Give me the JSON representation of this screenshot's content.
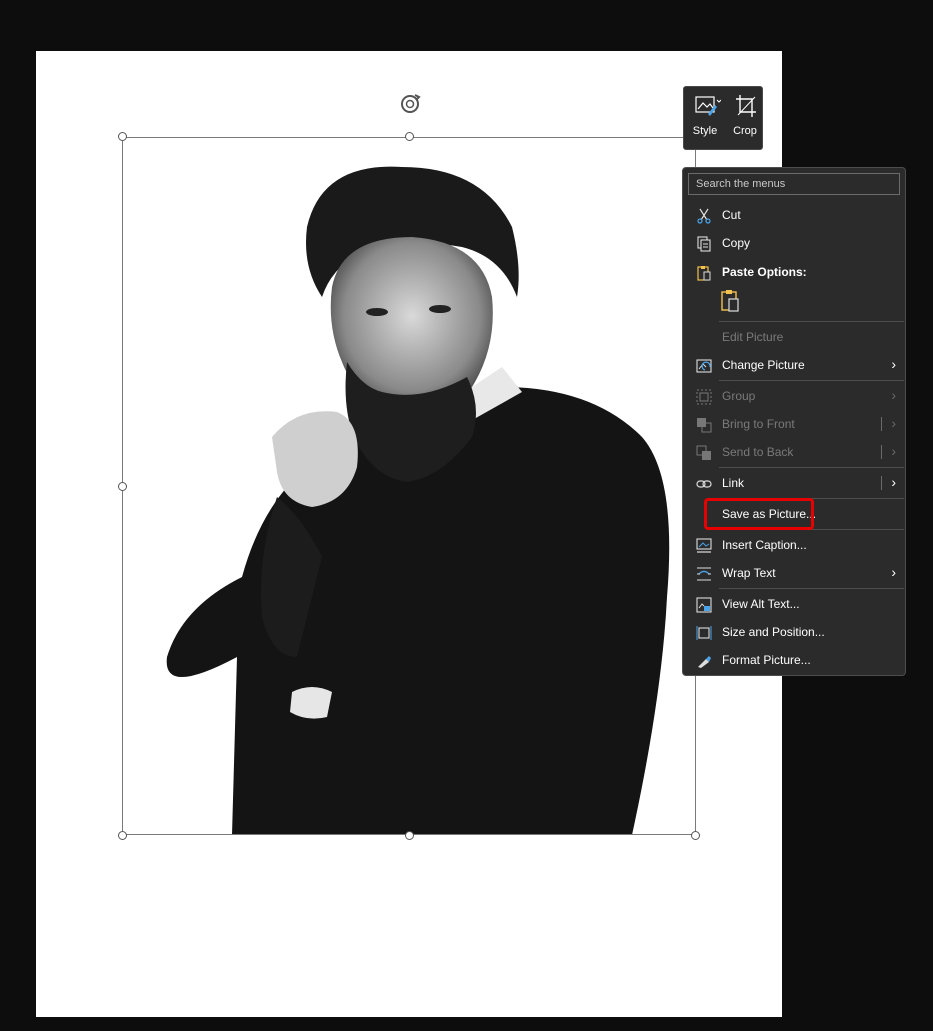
{
  "mini_toolbar": {
    "style_label": "Style",
    "crop_label": "Crop"
  },
  "context_menu": {
    "search_placeholder": "Search the menus",
    "cut": "Cut",
    "copy": "Copy",
    "paste_options": "Paste Options:",
    "edit_picture": "Edit Picture",
    "change_picture": "Change Picture",
    "group": "Group",
    "bring_to_front": "Bring to Front",
    "send_to_back": "Send to Back",
    "link": "Link",
    "save_as_picture": "Save as Picture...",
    "insert_caption": "Insert Caption...",
    "wrap_text": "Wrap Text",
    "view_alt_text": "View Alt Text...",
    "size_and_position": "Size and Position...",
    "format_picture": "Format Picture..."
  },
  "colors": {
    "menu_bg": "#2b2b2b",
    "highlight": "#e60000",
    "accent_icon": "#4aa3e8",
    "paste_icon": "#f2c14e"
  }
}
